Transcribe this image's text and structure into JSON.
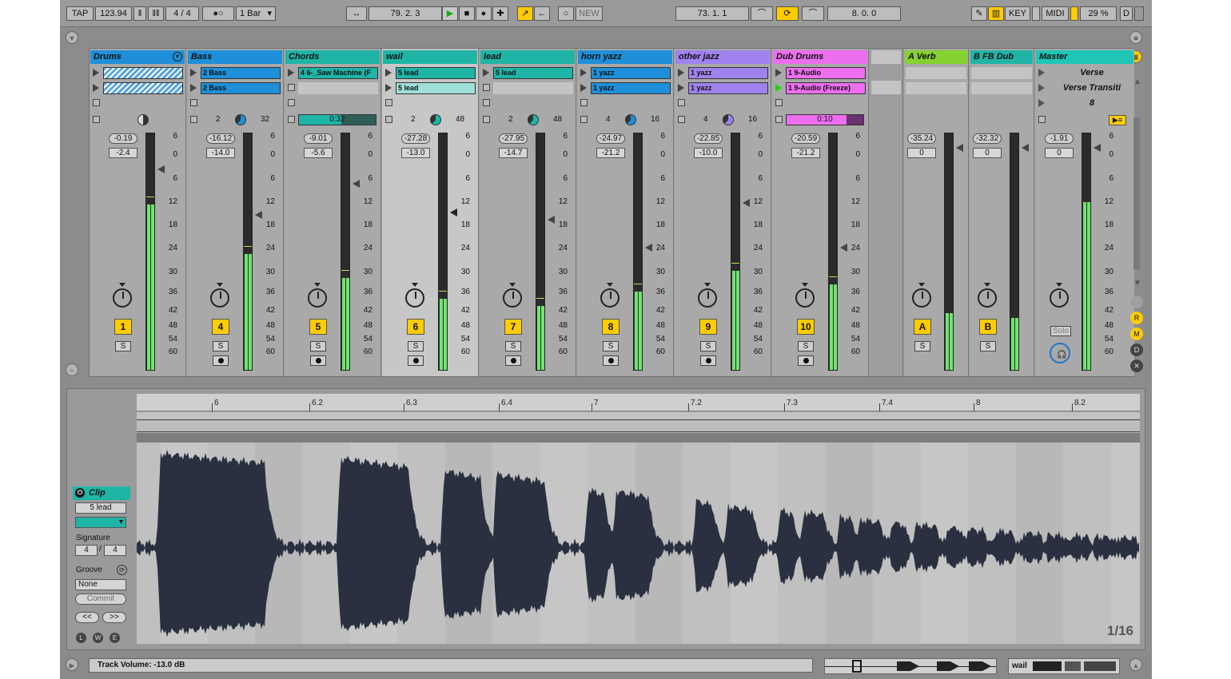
{
  "transport": {
    "tap_label": "TAP",
    "tempo": "123.94",
    "signature": "4 / 4",
    "metronome": "●○",
    "quantize": "1 Bar",
    "position": "79.  2.  3",
    "new_label": "NEW",
    "loop_start": "73.  1.  1",
    "loop_length": "8.  0.  0",
    "key_label": "KEY",
    "midi_label": "MIDI",
    "cpu": "29 %",
    "d_label": "D"
  },
  "tracks": [
    {
      "name": "Drums",
      "color": "#1e8fd8",
      "clips": [
        {
          "label": "",
          "color": "#62a7d8",
          "hatched": true
        },
        {
          "label": "",
          "color": "#62a7d8",
          "hatched": true
        }
      ],
      "status": "pie",
      "vol_peak": "-0.19",
      "vol": "-2.4",
      "number": "1"
    },
    {
      "name": "Bass",
      "color": "#1e8fd8",
      "clips": [
        {
          "label": "2 Bass",
          "color": "#1e8fd8"
        },
        {
          "label": "2 Bass",
          "color": "#1e8fd8"
        }
      ],
      "status_left": "2",
      "status_right": "32",
      "vol_peak": "-16.12",
      "vol": "-14.0",
      "number": "4"
    },
    {
      "name": "Chords",
      "color": "#1fb5a6",
      "clips": [
        {
          "label": "4 6-_Saw Machine (F",
          "color": "#1fb5a6"
        },
        null
      ],
      "status_bar": "0:32",
      "vol_peak": "-9.01",
      "vol": "-5.6",
      "number": "5"
    },
    {
      "name": "wail",
      "color": "#1fb5a6",
      "clips": [
        {
          "label": "5 lead",
          "color": "#1fb5a6"
        },
        {
          "label": "5 lead",
          "color": "#9ee0d8"
        }
      ],
      "status_left": "2",
      "status_right": "48",
      "vol_peak": "-27.28",
      "vol": "-13.0",
      "number": "6"
    },
    {
      "name": "lead",
      "color": "#1fb5a6",
      "clips": [
        {
          "label": "5 lead",
          "color": "#1fb5a6"
        },
        null
      ],
      "status_left": "2",
      "status_right": "48",
      "vol_peak": "-27.95",
      "vol": "-14.7",
      "number": "7"
    },
    {
      "name": "horn yazz",
      "color": "#1e8fd8",
      "clips": [
        {
          "label": "1 yazz",
          "color": "#1e8fd8"
        },
        {
          "label": "1 yazz",
          "color": "#1e8fd8"
        }
      ],
      "status_left": "4",
      "status_right": "16",
      "vol_peak": "-24.97",
      "vol": "-21.2",
      "number": "8"
    },
    {
      "name": "other jazz",
      "color": "#9f82ee",
      "clips": [
        {
          "label": "1 yazz",
          "color": "#9f82ee"
        },
        {
          "label": "1 yazz",
          "color": "#9f82ee"
        }
      ],
      "status_left": "4",
      "status_right": "16",
      "vol_peak": "-22.85",
      "vol": "-10.0",
      "number": "9"
    },
    {
      "name": "Dub Drums",
      "color": "#ee6ef0",
      "clips": [
        {
          "label": "1 9-Audio",
          "color": "#ee6ef0"
        },
        {
          "label": "1 9-Audio (Freeze)",
          "color": "#ee6ef0",
          "playing": true
        }
      ],
      "status_bar": "0:10",
      "vol_peak": "-20.59",
      "vol": "-21.2",
      "number": "10"
    }
  ],
  "returns": [
    {
      "name": "A Verb",
      "color": "#86d02f",
      "vol_peak": "-35.24",
      "vol": "0",
      "letter": "A"
    },
    {
      "name": "B FB Dub",
      "color": "#1fb5a6",
      "vol_peak": "-32.32",
      "vol": "0",
      "letter": "B"
    }
  ],
  "master": {
    "name": "Master",
    "color": "#1fc6b8",
    "scenes": [
      "Verse",
      "Verse Transiti",
      "8"
    ],
    "vol_peak": "-1.91",
    "vol": "0",
    "solo_label": "Solo"
  },
  "meter_scale": [
    "6",
    "0",
    "6",
    "12",
    "18",
    "24",
    "30",
    "36",
    "42",
    "48",
    "54",
    "60"
  ],
  "solo_label": "S",
  "clip_panel": {
    "title": "Clip",
    "name": "5 lead",
    "signature_label": "Signature",
    "sig_num": "4",
    "sig_den": "4",
    "groove_label": "Groove",
    "groove_value": "None",
    "commit_label": "Commit",
    "nudge_back": "<<",
    "nudge_fwd": ">>",
    "footer_icons": [
      "L",
      "W",
      "E"
    ]
  },
  "ruler_marks": [
    "6",
    "6.2",
    "6.3",
    "6.4",
    "7",
    "7.2",
    "7.3",
    "7.4",
    "8",
    "8.2"
  ],
  "grid_label": "1/16",
  "status": {
    "message": "Track Volume: -13.0 dB",
    "track_name": "wail"
  },
  "colors": {
    "accent": "#ffcc00",
    "play": "#1fd21f",
    "meter": "#6fe56f",
    "waveform": "#2a3040"
  }
}
